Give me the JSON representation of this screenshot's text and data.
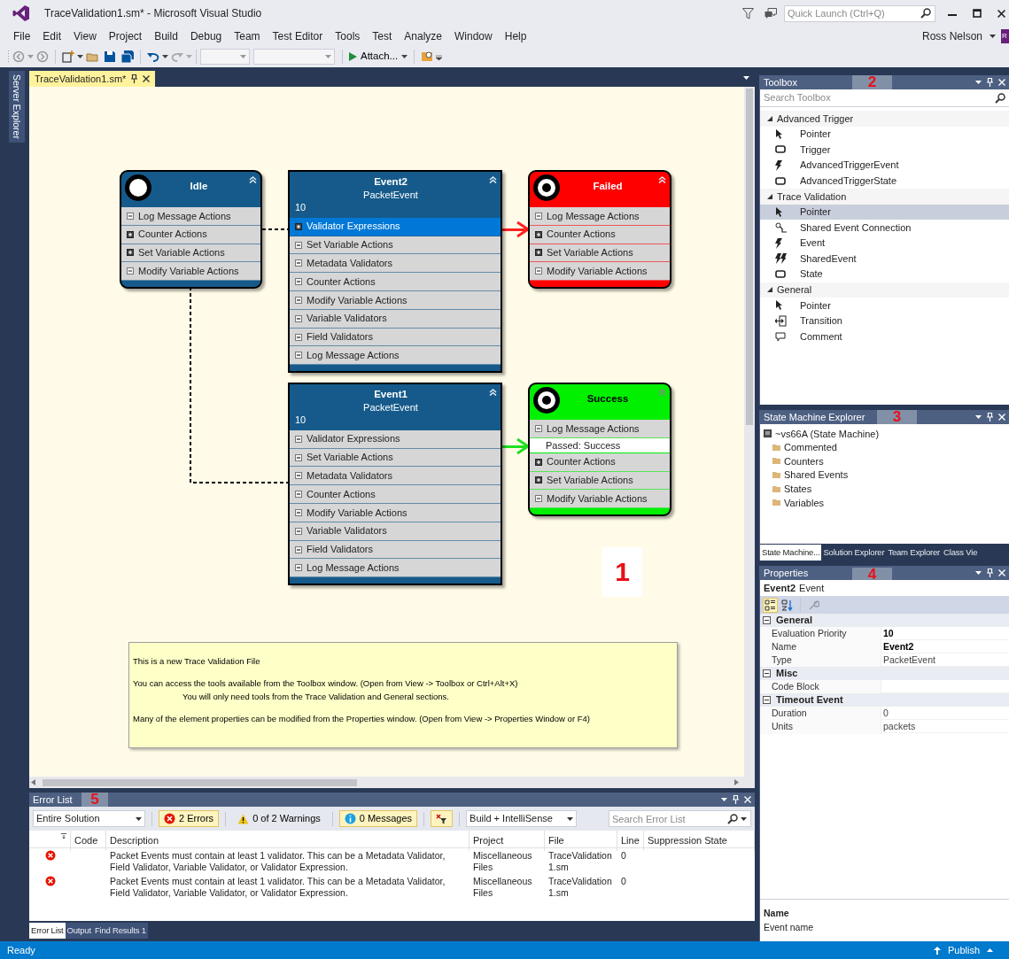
{
  "window": {
    "title": "TraceValidation1.sm* - Microsoft Visual Studio",
    "quick_launch_placeholder": "Quick Launch (Ctrl+Q)",
    "user": "Ross Nelson",
    "avatar": "R"
  },
  "menu": [
    "File",
    "Edit",
    "View",
    "Project",
    "Build",
    "Debug",
    "Team",
    "Test Editor",
    "Tools",
    "Test",
    "Analyze",
    "Window",
    "Help"
  ],
  "toolbar": {
    "attach_label": "Attach..."
  },
  "side_tabs": [
    "Server Explorer"
  ],
  "document_tabs": [
    {
      "label": "TraceValidation1.sm*",
      "selected": true
    }
  ],
  "diagram": {
    "nodes": [
      {
        "kind": "initial_state",
        "title": "Idle",
        "color": "#155a8a",
        "sections": [
          {
            "label": "Log Message Actions",
            "expanded": true,
            "selected": false
          },
          {
            "label": "Counter Actions",
            "expanded": false,
            "selected": false
          },
          {
            "label": "Set Variable Actions",
            "expanded": false,
            "selected": false
          },
          {
            "label": "Modify Variable Actions",
            "expanded": true,
            "selected": false
          }
        ]
      },
      {
        "kind": "event",
        "title": "Event2",
        "subtitle": "PacketEvent",
        "priority": "10",
        "color": "#155a8a",
        "sections": [
          {
            "label": "Validator Expressions",
            "expanded": false,
            "selected": true
          },
          {
            "label": "Set Variable Actions",
            "expanded": true,
            "selected": false
          },
          {
            "label": "Metadata Validators",
            "expanded": true,
            "selected": false
          },
          {
            "label": "Counter Actions",
            "expanded": true,
            "selected": false
          },
          {
            "label": "Modify Variable Actions",
            "expanded": true,
            "selected": false
          },
          {
            "label": "Variable Validators",
            "expanded": true,
            "selected": false
          },
          {
            "label": "Field Validators",
            "expanded": true,
            "selected": false
          },
          {
            "label": "Log Message Actions",
            "expanded": true,
            "selected": false
          }
        ]
      },
      {
        "kind": "final_state",
        "title": "Failed",
        "color": "#ff0000",
        "sections": [
          {
            "label": "Log Message Actions",
            "expanded": true,
            "selected": false
          },
          {
            "label": "Counter Actions",
            "expanded": false,
            "selected": false
          },
          {
            "label": "Set Variable Actions",
            "expanded": false,
            "selected": false
          },
          {
            "label": "Modify Variable Actions",
            "expanded": true,
            "selected": false
          }
        ]
      },
      {
        "kind": "event",
        "title": "Event1",
        "subtitle": "PacketEvent",
        "priority": "10",
        "color": "#155a8a",
        "sections": [
          {
            "label": "Validator Expressions",
            "expanded": true,
            "selected": false
          },
          {
            "label": "Set Variable Actions",
            "expanded": true,
            "selected": false
          },
          {
            "label": "Metadata Validators",
            "expanded": true,
            "selected": false
          },
          {
            "label": "Counter Actions",
            "expanded": true,
            "selected": false
          },
          {
            "label": "Modify Variable Actions",
            "expanded": true,
            "selected": false
          },
          {
            "label": "Variable Validators",
            "expanded": true,
            "selected": false
          },
          {
            "label": "Field Validators",
            "expanded": true,
            "selected": false
          },
          {
            "label": "Log Message Actions",
            "expanded": true,
            "selected": false
          }
        ]
      },
      {
        "kind": "final_state",
        "title": "Success",
        "color": "#00f000",
        "sections": [
          {
            "label": "Log Message Actions",
            "expanded": true,
            "selected": false,
            "children": [
              {
                "label": "Passed: Success"
              }
            ]
          },
          {
            "label": "Counter Actions",
            "expanded": false,
            "selected": false
          },
          {
            "label": "Set Variable Actions",
            "expanded": false,
            "selected": false
          },
          {
            "label": "Modify Variable Actions",
            "expanded": true,
            "selected": false
          }
        ]
      }
    ],
    "connectors": [
      {
        "kind": "dashed"
      },
      {
        "kind": "dashed"
      },
      {
        "kind": "arrow",
        "color": "#ff2020"
      },
      {
        "kind": "arrow",
        "color": "#20e020"
      }
    ],
    "comment": [
      [
        "This is a new Trace Validation File"
      ],
      [
        "You can access the tools available from the Toolbox window. (Open from View -> Toolbox or Ctrl+Alt+X)",
        "You will only need tools from the Trace Validation and General sections."
      ],
      [
        "Many of the element properties can be modified from the Properties window. (Open from View -> Properties Window or F4)"
      ]
    ]
  },
  "callouts": [
    "1",
    "2",
    "3",
    "4",
    "5"
  ],
  "toolbox": {
    "title": "Toolbox",
    "search_placeholder": "Search Toolbox",
    "groups": [
      {
        "label": "Advanced Trigger",
        "expanded": true,
        "items": [
          {
            "label": "Pointer",
            "kind": "pointer",
            "selected": false
          },
          {
            "label": "Trigger",
            "kind": "state",
            "selected": false
          },
          {
            "label": "AdvancedTriggerEvent",
            "kind": "event",
            "selected": false
          },
          {
            "label": "AdvancedTriggerState",
            "kind": "state",
            "selected": false
          }
        ]
      },
      {
        "label": "Trace Validation",
        "expanded": true,
        "items": [
          {
            "label": "Pointer",
            "kind": "pointer",
            "selected": true
          },
          {
            "label": "Shared Event Connection",
            "kind": "connection",
            "selected": false
          },
          {
            "label": "Event",
            "kind": "event",
            "selected": false
          },
          {
            "label": "SharedEvent",
            "kind": "shared_event",
            "selected": false
          },
          {
            "label": "State",
            "kind": "state",
            "selected": false
          }
        ]
      },
      {
        "label": "General",
        "expanded": true,
        "items": [
          {
            "label": "Pointer",
            "kind": "pointer",
            "selected": false
          },
          {
            "label": "Transition",
            "kind": "transition",
            "selected": false
          },
          {
            "label": "Comment",
            "kind": "comment",
            "selected": false
          }
        ]
      }
    ]
  },
  "state_machine_explorer": {
    "title": "State Machine Explorer",
    "root": {
      "label": "~vs66A (State Machine)",
      "children": [
        {
          "label": "Commented"
        },
        {
          "label": "Counters"
        },
        {
          "label": "Shared Events"
        },
        {
          "label": "States"
        },
        {
          "label": "Variables"
        }
      ]
    },
    "tabs": [
      {
        "label": "State Machine...",
        "selected": true
      },
      {
        "label": "Solution Explorer",
        "selected": false
      },
      {
        "label": "Team Explorer",
        "selected": false
      },
      {
        "label": "Class Vie",
        "selected": false
      }
    ]
  },
  "properties": {
    "title": "Properties",
    "object_name": "Event2",
    "object_type": "Event",
    "toolbar": [
      {
        "kind": "categorized",
        "selected": true,
        "disabled": false
      },
      {
        "kind": "alphabetical",
        "selected": false,
        "disabled": false
      },
      {
        "kind": "property_pages",
        "selected": false,
        "disabled": true
      }
    ],
    "categories": [
      {
        "label": "General",
        "expanded": true,
        "rows": [
          {
            "name": "Evaluation Priority",
            "value": "10",
            "modified": true
          },
          {
            "name": "Name",
            "value": "Event2",
            "modified": true
          },
          {
            "name": "Type",
            "value": "PacketEvent",
            "modified": false
          }
        ]
      },
      {
        "label": "Misc",
        "expanded": true,
        "rows": [
          {
            "name": "Code Block"
          }
        ]
      },
      {
        "label": "Timeout Event",
        "expanded": true,
        "rows": [
          {
            "name": "Duration",
            "value": "0",
            "modified": false
          },
          {
            "name": "Units",
            "value": "packets",
            "modified": false
          }
        ]
      }
    ],
    "description": {
      "title": "Name",
      "text": "Event name"
    }
  },
  "error_list": {
    "title": "Error List",
    "scope": "Entire Solution",
    "filters": [
      {
        "kind": "error",
        "label": "2 Errors",
        "selected": true
      },
      {
        "kind": "warning",
        "label": "0 of 2 Warnings",
        "selected": false
      },
      {
        "kind": "info",
        "label": "0 Messages",
        "selected": true
      }
    ],
    "source": "Build + IntelliSense",
    "search_placeholder": "Search Error List",
    "columns": [
      "Code",
      "Description",
      "Project",
      "File",
      "Line",
      "Suppression State"
    ],
    "rows": [
      {
        "kind": "error",
        "description": "Packet Events must contain at least 1 validator. This can be a Metadata Validator, Field Validator, Variable Validator, or Validator Expression.",
        "project": "Miscellaneous Files",
        "file": "TraceValidation1.sm",
        "line": "0"
      },
      {
        "kind": "error",
        "description": "Packet Events must contain at least 1 validator. This can be a Metadata Validator, Field Validator, Variable Validator, or Validator Expression.",
        "project": "Miscellaneous Files",
        "file": "TraceValidation1.sm",
        "line": "0"
      }
    ],
    "tabs": [
      {
        "label": "Error List",
        "selected": true
      },
      {
        "label": "Output",
        "selected": false
      },
      {
        "label": "Find Results 1",
        "selected": false
      }
    ]
  },
  "status_bar": {
    "text": "Ready",
    "publish": "Publish"
  }
}
